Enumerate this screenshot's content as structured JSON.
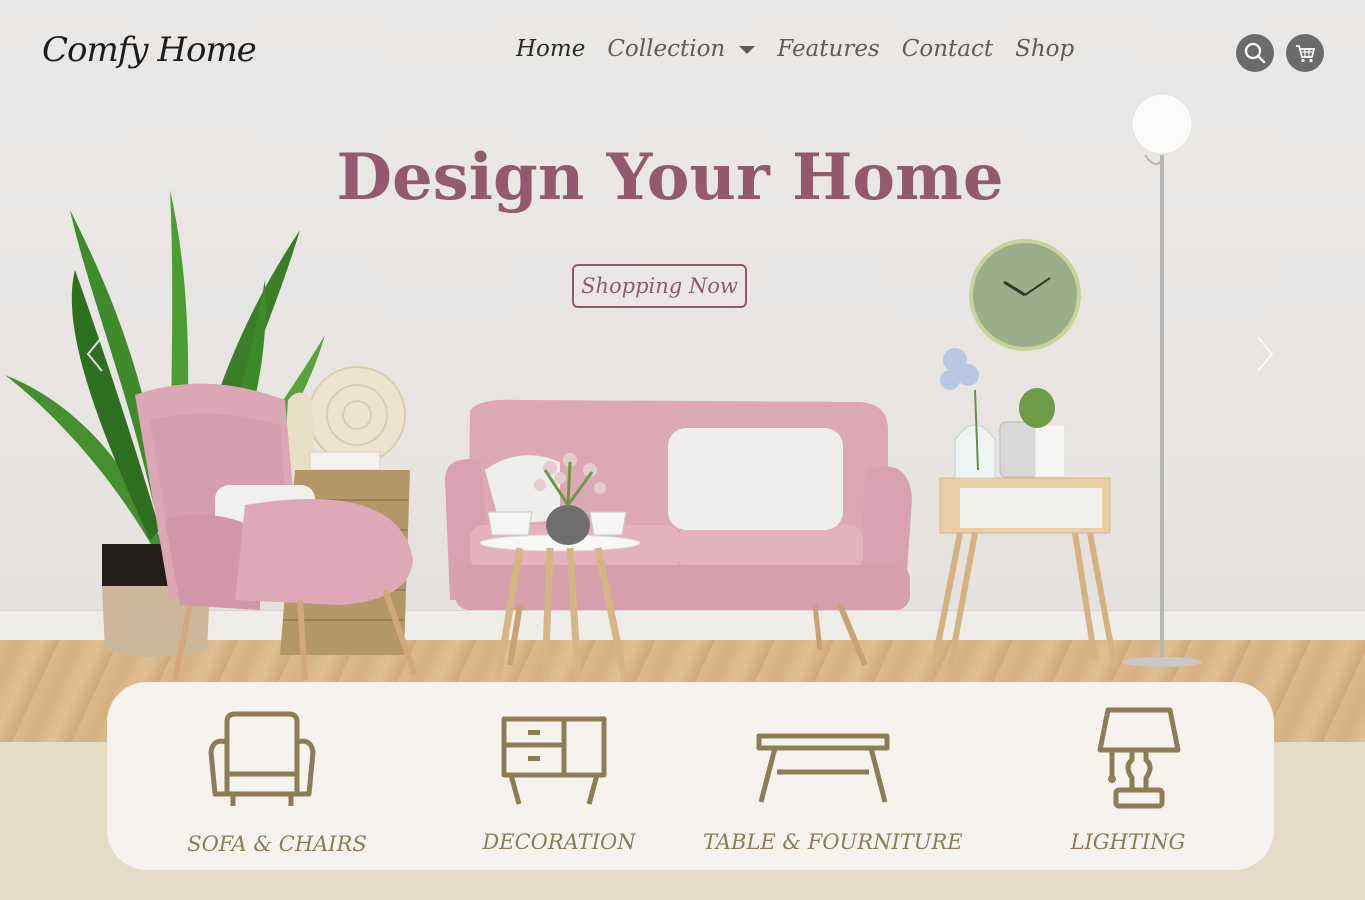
{
  "brand": {
    "logo": "Comfy Home"
  },
  "nav": {
    "items": [
      {
        "label": "Home"
      },
      {
        "label": "Collection"
      },
      {
        "label": "Features"
      },
      {
        "label": "Contact"
      },
      {
        "label": "Shop"
      }
    ],
    "icons": [
      "search-icon",
      "cart-icon"
    ]
  },
  "hero": {
    "title": "Design Your Home",
    "cta": "Shopping Now"
  },
  "categories": [
    {
      "label": "SOFA & CHAIRS",
      "icon": "armchair-icon"
    },
    {
      "label": "DECORATION",
      "icon": "cabinet-icon"
    },
    {
      "label": "TABLE & FOURNITURE",
      "icon": "table-icon"
    },
    {
      "label": "LIGHTING",
      "icon": "lamp-icon"
    }
  ],
  "colors": {
    "accent": "#93596f",
    "category": "#8e7c55",
    "panel": "#f6f3ef",
    "footer_band": "#e3ddc8"
  }
}
